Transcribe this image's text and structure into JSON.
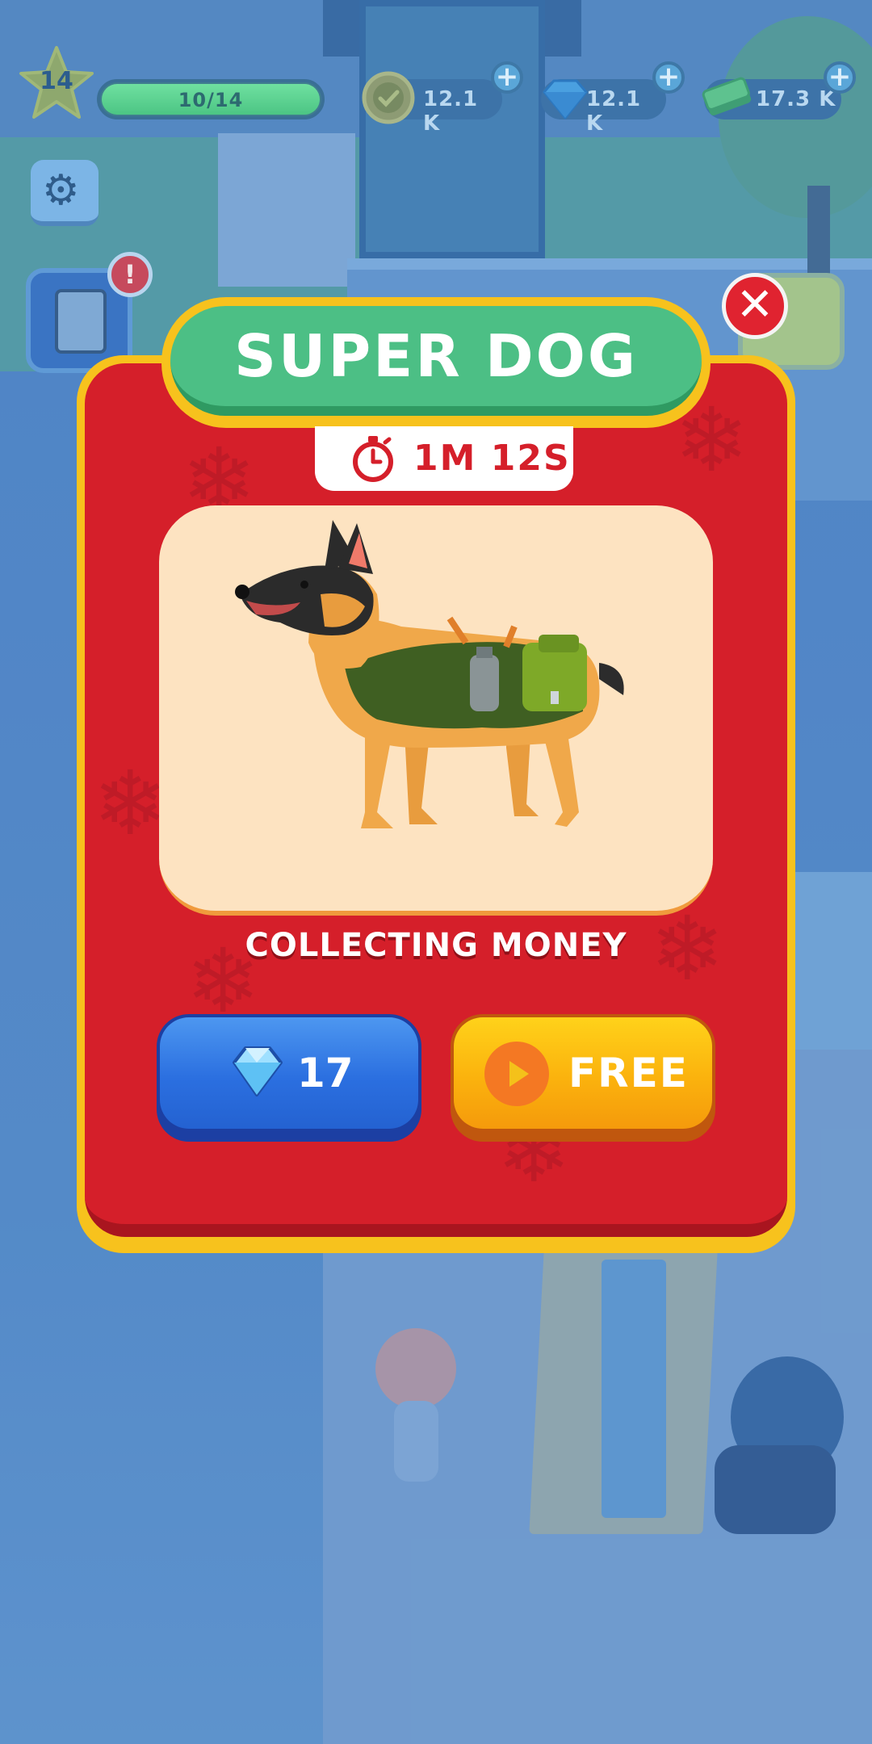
{
  "hud": {
    "level": "14",
    "xp_text": "10/14",
    "xp_progress": 1.0,
    "currencies": [
      {
        "name": "coins",
        "icon": "coin-icon",
        "value": "12.1 K"
      },
      {
        "name": "gems",
        "icon": "gem-icon",
        "value": "12.1 K"
      },
      {
        "name": "cash",
        "icon": "cash-icon",
        "value": "17.3 K"
      }
    ],
    "plus_label": "+",
    "tasks_alert": "!"
  },
  "offer": {
    "title": "SUPER DOG",
    "timer": "1M 12S",
    "pet_icon": "dog-icon",
    "description": "COLLECTING MONEY",
    "gem_price": "17",
    "free_label": "FREE",
    "close_label": "✕"
  },
  "colors": {
    "modal_red": "#d51f2a",
    "frame_yellow": "#f7c21d",
    "title_green": "#4cbf85",
    "gem_blue": "#2b6fe0",
    "free_orange": "#fbb20d"
  }
}
